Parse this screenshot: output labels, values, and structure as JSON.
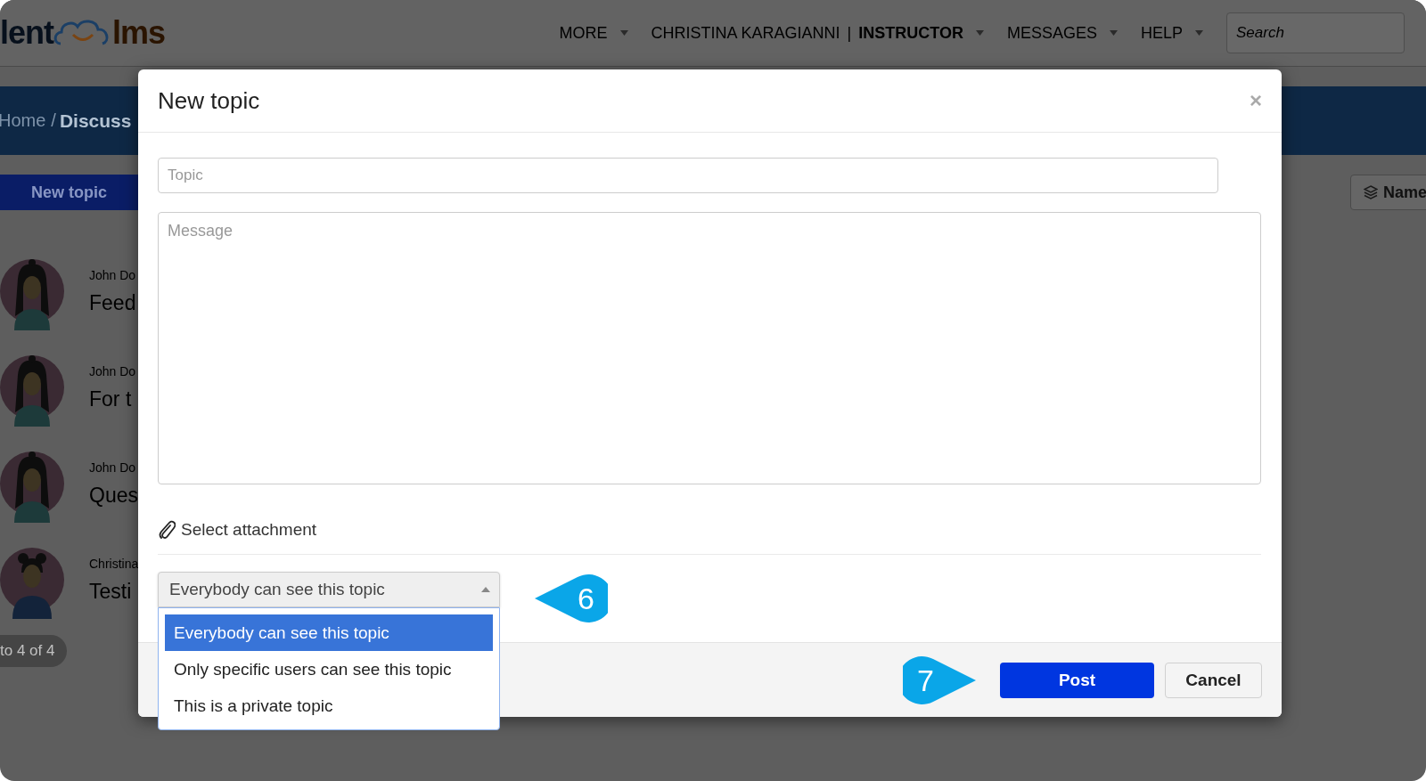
{
  "header": {
    "logo": {
      "left": "lent",
      "right": "lms"
    },
    "nav": [
      {
        "kind": "link",
        "label": "MORE"
      },
      {
        "kind": "user",
        "label": "CHRISTINA KARAGIANNI",
        "separator": "|",
        "role": "INSTRUCTOR"
      },
      {
        "kind": "link",
        "label": "MESSAGES"
      },
      {
        "kind": "link",
        "label": "HELP"
      }
    ],
    "search": {
      "placeholder": "Search"
    }
  },
  "banner": {
    "breadcrumb": [
      {
        "label": "Home",
        "current": false
      },
      {
        "label": "Discuss",
        "current": true
      }
    ],
    "separator": "/"
  },
  "toolbar": {
    "new_topic_button": "New topic",
    "sort_button": "Name"
  },
  "topics": [
    {
      "author": "John Do",
      "title": "Feed",
      "kind": "long-hair"
    },
    {
      "author": "John Do",
      "title": "For t",
      "kind": "long-hair"
    },
    {
      "author": "John Do",
      "title": "Ques",
      "kind": "long-hair"
    },
    {
      "author": "Christina",
      "title": "Testi",
      "kind": "buns"
    }
  ],
  "pagination": "to 4 of 4",
  "modal": {
    "title": "New topic",
    "close": "×",
    "topic_field": {
      "placeholder": "Topic"
    },
    "message_field": {
      "placeholder": "Message"
    },
    "attachment": "Select attachment",
    "visibility_select": {
      "value": "Everybody can see this topic",
      "expanded": true,
      "options": [
        {
          "label": "Everybody can see this topic",
          "selected": true
        },
        {
          "label": "Only specific users can see this topic",
          "selected": false
        },
        {
          "label": "This is a private topic",
          "selected": false
        }
      ]
    },
    "buttons": [
      {
        "kind": "primary",
        "label": "Post"
      },
      {
        "kind": "secondary",
        "label": "Cancel"
      }
    ]
  },
  "callouts": [
    {
      "number": "6",
      "kind": "left"
    },
    {
      "number": "7",
      "kind": "right"
    }
  ]
}
